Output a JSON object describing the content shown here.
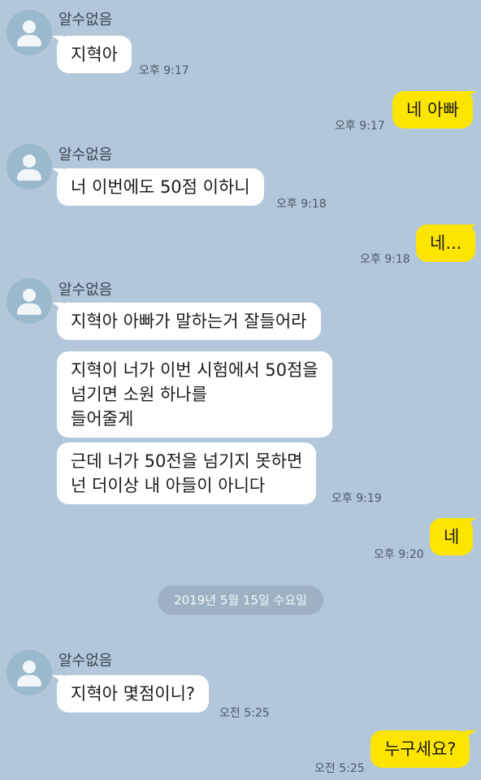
{
  "chat": {
    "sender_name": "알수없음",
    "date_divider": "2019년 5월 15일 수요일",
    "messages": {
      "m1": {
        "text": "지혁아",
        "time": "오후 9:17"
      },
      "m2": {
        "text": "네 아빠",
        "time": "오후 9:17"
      },
      "m3": {
        "text": "너 이번에도 50점 이하니",
        "time": "오후 9:18"
      },
      "m4": {
        "text": "네...",
        "time": "오후 9:18"
      },
      "m5": {
        "text": "지혁아 아빠가 말하는거 잘들어라"
      },
      "m6": {
        "text": "지혁이 너가 이번 시험에서 50점을\n넘기면 소원 하나를\n들어줄게"
      },
      "m7": {
        "text": "근데 너가 50전을 넘기지 못하면\n넌 더이상 내 아들이 아니다",
        "time": "오후 9:19"
      },
      "m8": {
        "text": "네",
        "time": "오후 9:20"
      },
      "m9": {
        "text": "지혁아 몇점이니?",
        "time": "오전 5:25"
      },
      "m10": {
        "text": "누구세요?",
        "time": "오전 5:25"
      }
    }
  },
  "colors": {
    "background": "#b2c7d9",
    "incoming_bubble": "#ffffff",
    "outgoing_bubble": "#fee500"
  },
  "icons": {
    "avatar": "default-profile-icon"
  }
}
